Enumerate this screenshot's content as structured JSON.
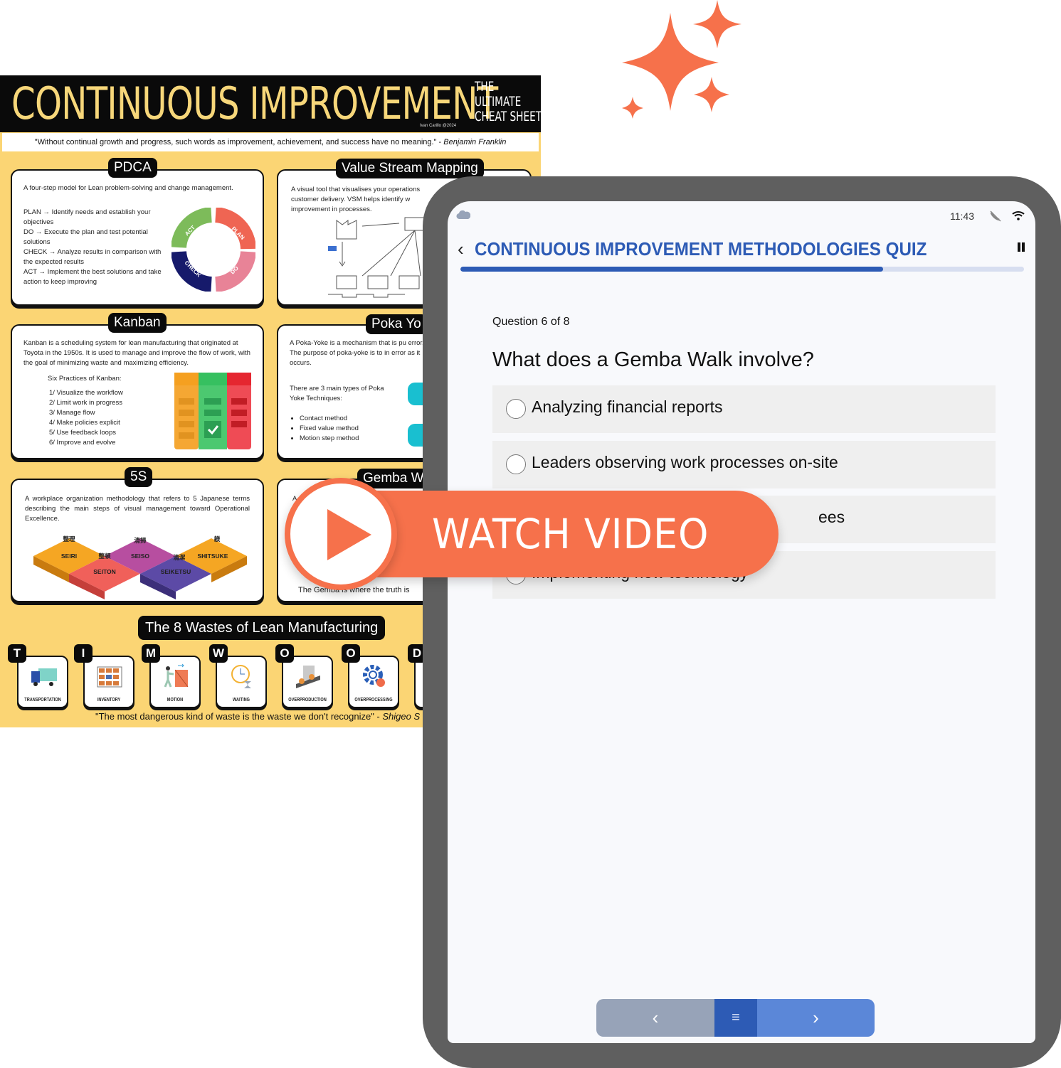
{
  "poster": {
    "title": "CONTINUOUS IMPROVEMENT",
    "subtitle_lines": [
      "THE",
      "ULTIMATE",
      "CHEAT SHEET"
    ],
    "credit": "Ivan Carillo @2024",
    "quote": "\"Without continual growth and progress, such words as improvement, achievement, and success have no meaning.\" - ",
    "quote_author": "Benjamin Franklin",
    "colors": {
      "background": "#fbd574",
      "header": "#0a0a0a",
      "title": "#f7d77a"
    },
    "pdca": {
      "tag": "PDCA",
      "intro": "A four-step model for Lean problem-solving and change management.",
      "steps": [
        "PLAN → Identify needs and establish your objectives",
        "DO → Execute the plan and test potential solutions",
        "CHECK → Analyze results in comparison with the expected results",
        "ACT → Implement the best solutions and take action to keep improving"
      ],
      "ring_labels": [
        "PLAN",
        "DO",
        "CHECK",
        "ACT"
      ]
    },
    "vsm": {
      "tag": "Value Stream Mapping",
      "text": "A visual tool that visualises your operations customer delivery. VSM helps identify w improvement in processes."
    },
    "kanban": {
      "tag": "Kanban",
      "text": "Kanban is a scheduling system for lean manufacturing that originated at Toyota in the 1950s. It is used to manage and improve the flow of work, with the goal of minimizing waste and maximizing efficiency.",
      "practices_title": "Six Practices of Kanban:",
      "practices": [
        "1/  Visualize the workflow",
        "2/  Limit work in progress",
        "3/  Manage flow",
        "4/  Make policies explicit",
        "5/  Use feedback loops",
        "6/  Improve and evolve"
      ]
    },
    "poka_yoke": {
      "tag": "Poka Yo",
      "text": "A Poka-Yoke is a mechanism that is pu error. The purpose of poka-yoke is to in error as it occurs.",
      "types_intro": "There are 3 main types of Poka Yoke Techniques:",
      "types": [
        "Contact method",
        "Fixed value method",
        "Motion step method"
      ]
    },
    "five_s": {
      "tag": "5S",
      "text": "A workplace organization methodology that refers to 5 Japanese terms describing the main steps of visual management toward Operational Excellence.",
      "steps": [
        {
          "label": "SEIRI",
          "kanji": "整理",
          "color": "#f5a623"
        },
        {
          "label": "SEITON",
          "kanji": "整頓",
          "color": "#f0605a"
        },
        {
          "label": "SEISO",
          "kanji": "清掃",
          "color": "#b74ea0"
        },
        {
          "label": "SEIKETSU",
          "kanji": "清潔",
          "color": "#5c4aa6"
        },
        {
          "label": "SHITSUKE",
          "kanji": "躾",
          "color": "#f5a623"
        }
      ]
    },
    "gemba": {
      "tag": "Gemba W",
      "text_start": "A",
      "footer": "The Gemba is where the truth is"
    },
    "wastes": {
      "title": "The 8 Wastes of Lean Manufacturing",
      "items": [
        {
          "letter": "T",
          "label": "TRANSPORTATION"
        },
        {
          "letter": "I",
          "label": "INVENTORY"
        },
        {
          "letter": "M",
          "label": "MOTION"
        },
        {
          "letter": "W",
          "label": "WAITING"
        },
        {
          "letter": "O",
          "label": "OVERPRODUCTION"
        },
        {
          "letter": "O",
          "label": "OVERPROCESSING"
        },
        {
          "letter": "D",
          "label": ""
        }
      ],
      "quote": "\"The most dangerous kind of waste is the waste we don't recognize\" - ",
      "quote_author": "Shigeo S"
    }
  },
  "watch_video": {
    "label": "WATCH VIDEO",
    "color": "#f6714b"
  },
  "tablet": {
    "status_bar": {
      "time": "11:43",
      "icons": [
        "cloud-icon",
        "mute-icon",
        "wifi-icon"
      ]
    },
    "header": {
      "back_label": "‹",
      "title": "CONTINUOUS IMPROVEMENT METHODOLOGIES QUIZ",
      "pause_icon": "pause-icon"
    },
    "progress": {
      "value": 0.75,
      "accent": "#2d5bb5"
    },
    "question": {
      "counter": "Question 6 of 8",
      "text": "What does a Gemba Walk involve?",
      "options": [
        {
          "label": "Analyzing financial reports",
          "selected": false
        },
        {
          "label": "Leaders observing work processes on-site",
          "selected": false
        },
        {
          "label": "ees",
          "selected": false,
          "partially_hidden": true
        },
        {
          "label": "Implementing new technology",
          "selected": false,
          "partially_hidden": true
        }
      ]
    },
    "nav": {
      "prev_label": "‹",
      "menu_label": "≡",
      "next_label": "›",
      "colors": {
        "prev": "#97a3b8",
        "menu": "#2d5bb5",
        "next": "#5b87d8"
      }
    }
  }
}
